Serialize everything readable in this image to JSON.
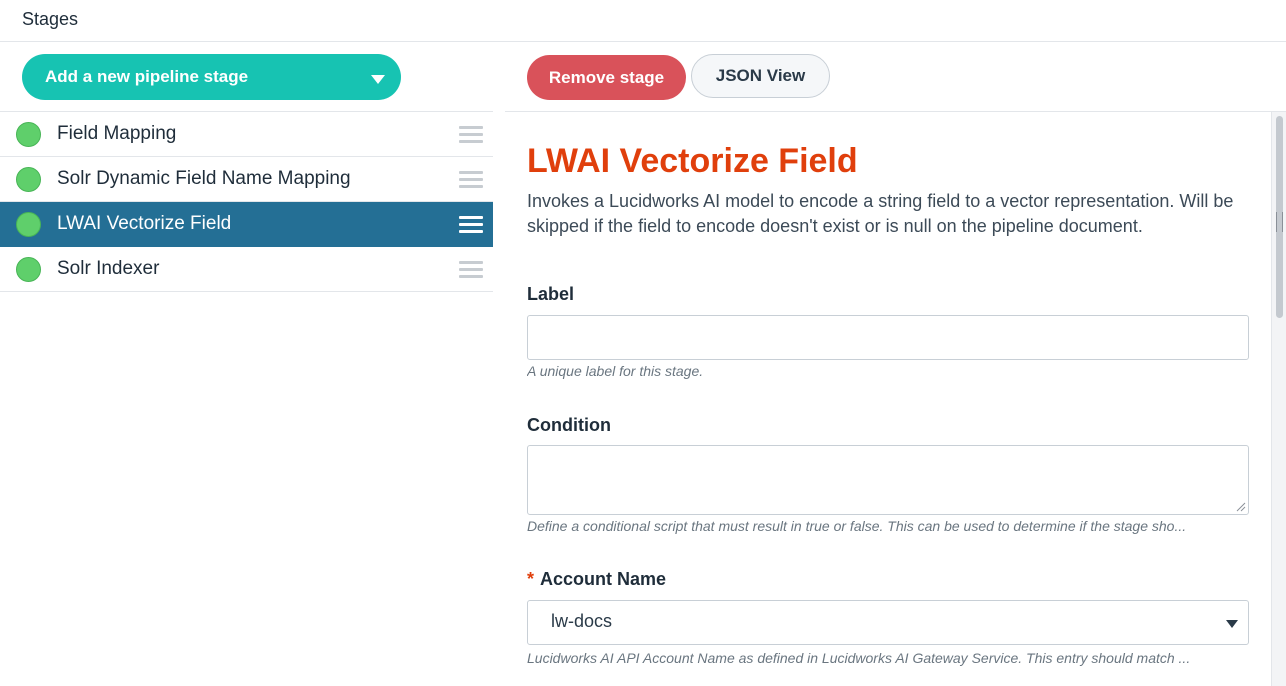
{
  "header": {
    "title": "Stages"
  },
  "sidebar": {
    "add_button_label": "Add a new pipeline stage",
    "stages": [
      {
        "label": "Field Mapping",
        "active": false
      },
      {
        "label": "Solr Dynamic Field Name Mapping",
        "active": false
      },
      {
        "label": "LWAI Vectorize Field",
        "active": true
      },
      {
        "label": "Solr Indexer",
        "active": false
      }
    ]
  },
  "toolbar": {
    "remove_label": "Remove stage",
    "json_label": "JSON View"
  },
  "form": {
    "title": "LWAI Vectorize Field",
    "description": "Invokes a Lucidworks AI model to encode a string field to a vector representation. Will be skipped if the field to encode doesn't exist or is null on the pipeline document.",
    "label_field": {
      "label": "Label",
      "value": "",
      "help": "A unique label for this stage."
    },
    "condition_field": {
      "label": "Condition",
      "value": "",
      "help": "Define a conditional script that must result in true or false. This can be used to determine if the stage sho..."
    },
    "account_field": {
      "required_marker": "*",
      "label": "Account Name",
      "value": "lw-docs",
      "help": "Lucidworks AI API Account Name as defined in Lucidworks AI Gateway Service.  This entry should match ..."
    }
  },
  "colors": {
    "accent_teal": "#17c3b2",
    "danger_red": "#d9525a",
    "title_orange": "#e03f0c",
    "active_row": "#246f95",
    "status_green": "#5fcf6b"
  },
  "icons": {
    "dropdown": "caret-down-icon",
    "drag": "drag-handle-icon",
    "status": "status-dot-icon"
  }
}
